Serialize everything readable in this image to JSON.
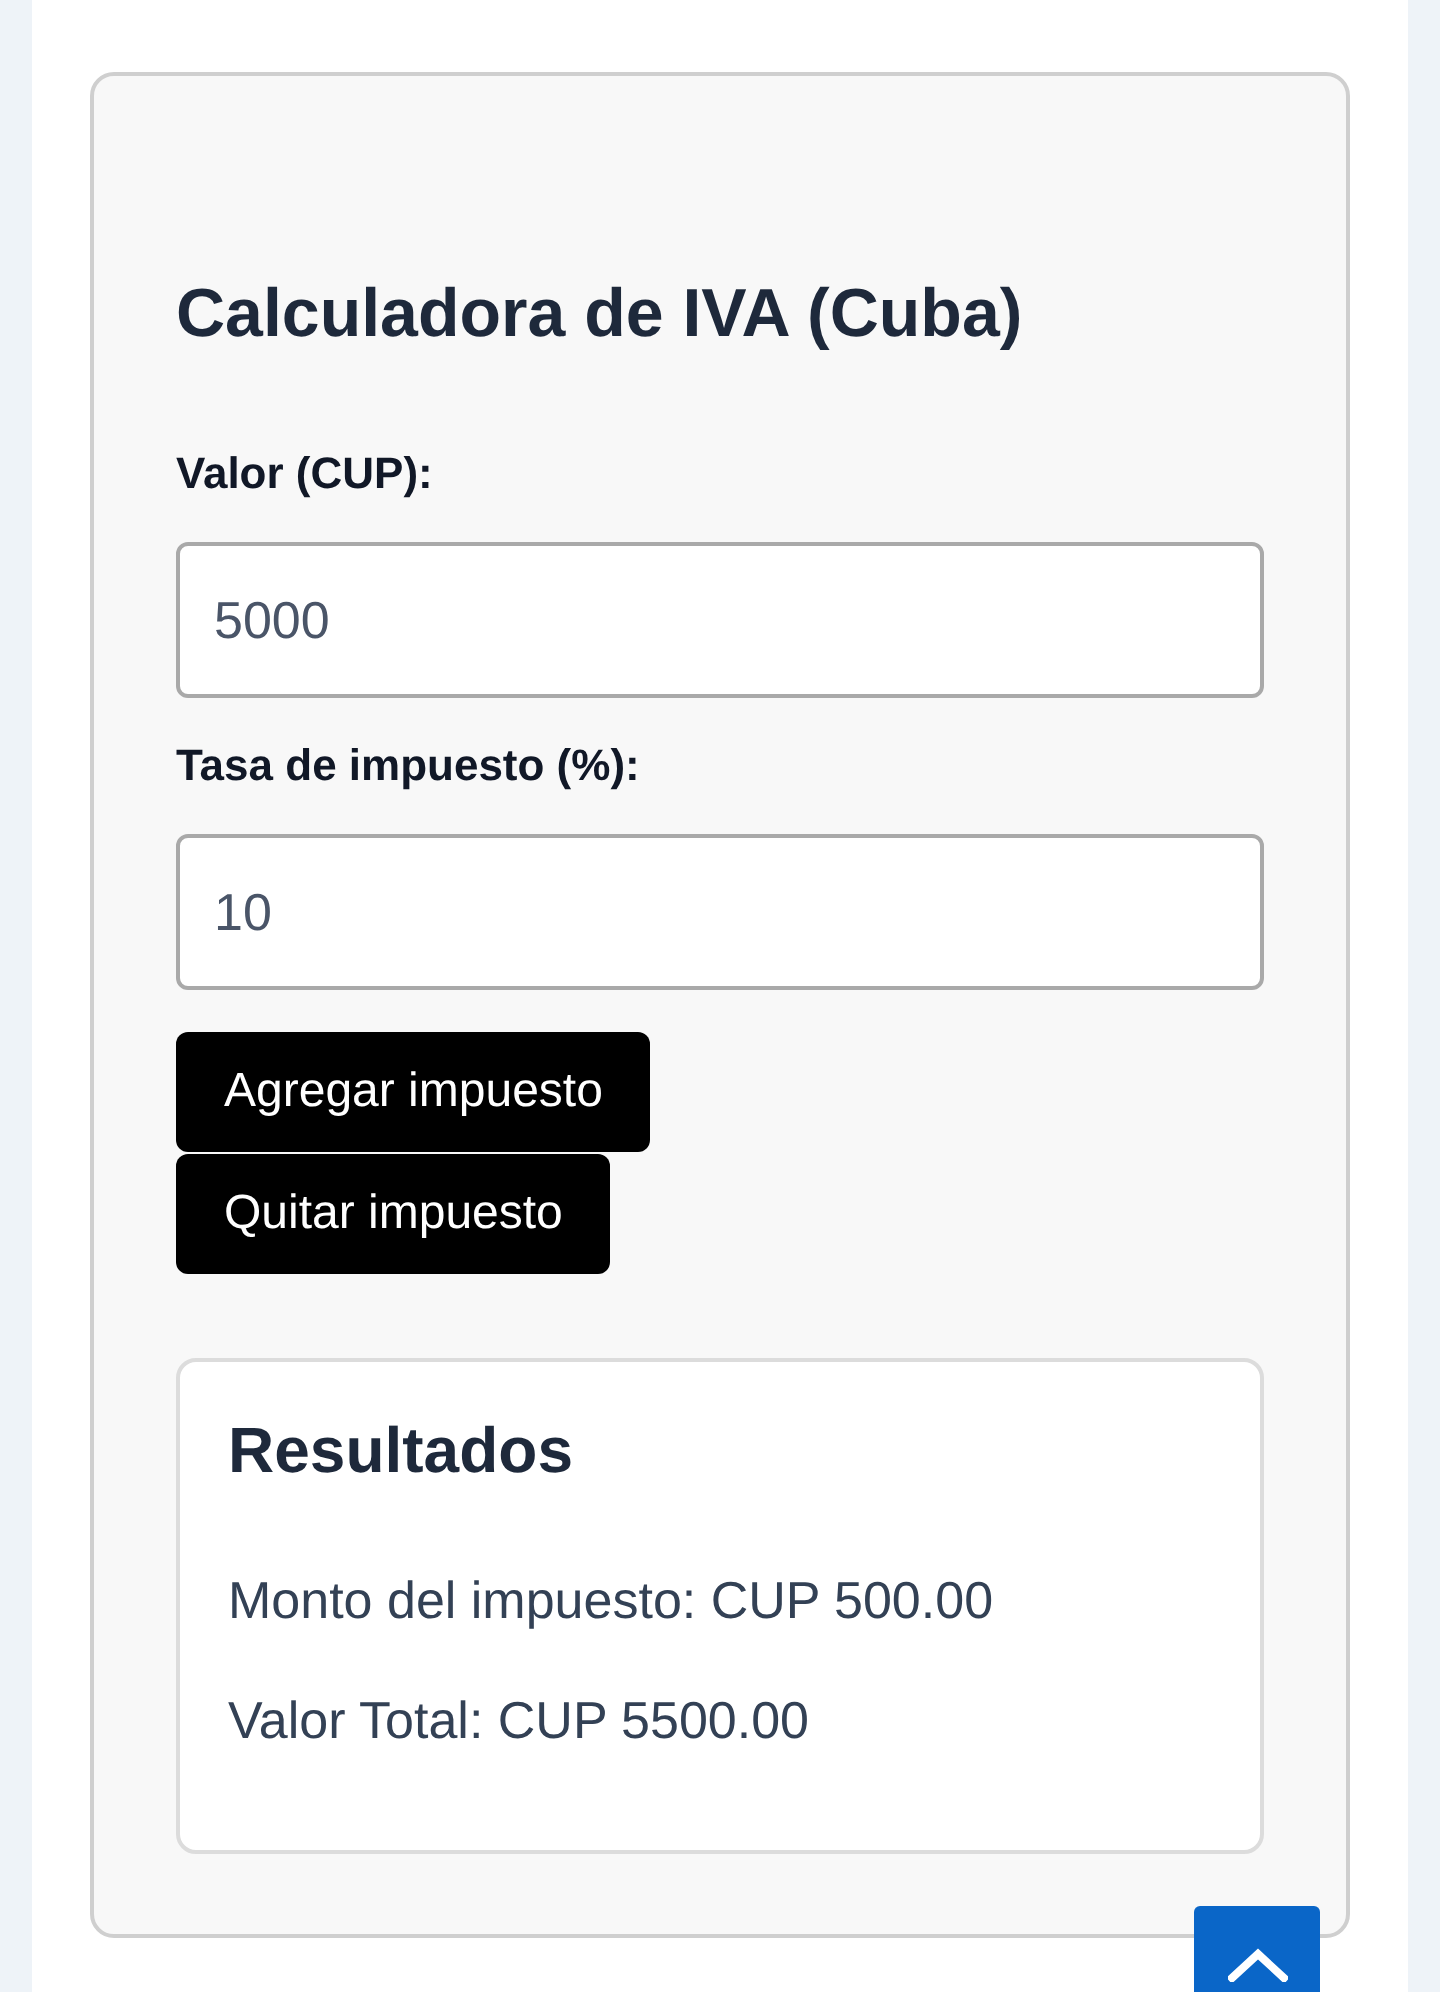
{
  "card": {
    "title": "Calculadora de IVA (Cuba)",
    "fields": [
      {
        "label": "Valor (CUP):",
        "value": "5000"
      },
      {
        "label": "Tasa de impuesto (%):",
        "value": "10"
      }
    ],
    "buttons": [
      "Agregar impuesto",
      "Quitar impuesto"
    ],
    "results": {
      "title": "Resultados",
      "lines": [
        "Monto del impuesto: CUP 500.00",
        "Valor Total: CUP 5500.00"
      ]
    }
  }
}
